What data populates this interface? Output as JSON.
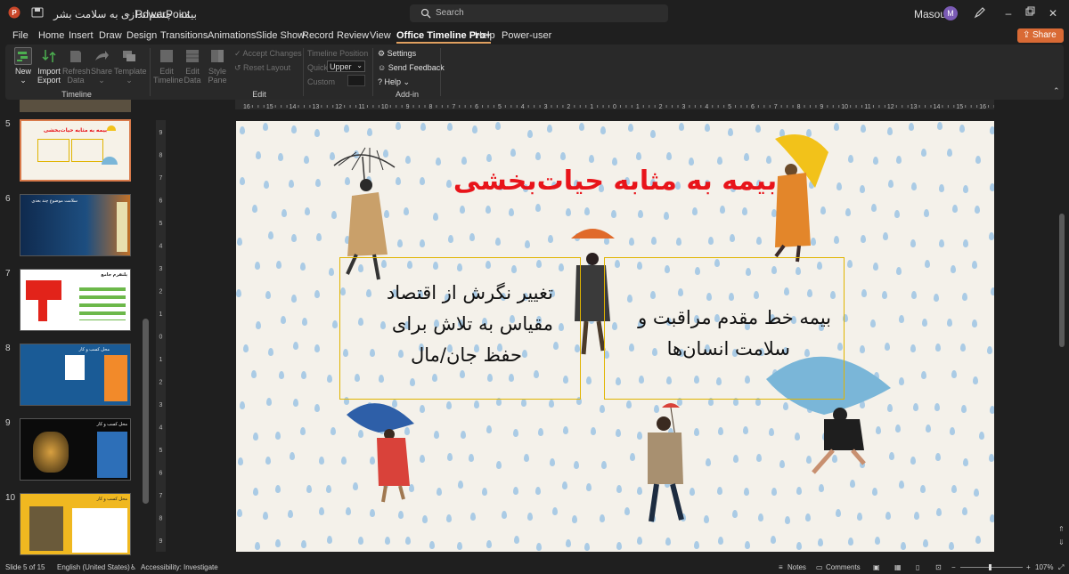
{
  "titlebar": {
    "autosave_label": "",
    "doc_title": "بیمه، چشم‌انداز‌ی به سلامت بشر",
    "app_name": "PowerPoint",
    "search_placeholder": "Search",
    "user_name": "Masoud",
    "avatar_initial": "M"
  },
  "menu": {
    "tabs": [
      "File",
      "Home",
      "Insert",
      "Draw",
      "Design",
      "Transitions",
      "Animations",
      "Slide Show",
      "Record",
      "Review",
      "View",
      "Office Timeline Pro+",
      "Help",
      "Power-user"
    ],
    "share_label": "Share"
  },
  "ribbon": {
    "new_label": "New",
    "import_label": "Import",
    "export_label": "Export",
    "refresh_label": "Refresh",
    "refresh_label2": "Data",
    "share_label": "Share",
    "template_label": "Template",
    "group_timeline": "Timeline",
    "accept_changes": "Accept Changes",
    "reset_layout": "Reset Layout",
    "edit_label": "Edit",
    "timeline_label": "Timeline",
    "data_label": "Data",
    "style_label": "Style",
    "pane_label": "Pane",
    "group_edit": "Edit",
    "timeline_position": "Timeline Position",
    "quick_label": "Quick",
    "quick_value": "Upper",
    "custom_label": "Custom",
    "settings_label": "Settings",
    "feedback_label": "Send Feedback",
    "help_label": "Help",
    "group_addin": "Add-in"
  },
  "thumbnails": [
    {
      "number": "5",
      "title": "بیمه به مثابه حیات‌بخشی"
    },
    {
      "number": "6",
      "title": "سلامت موضوع چند بعدی"
    },
    {
      "number": "7",
      "title": "پلتفرم جامع"
    },
    {
      "number": "8",
      "title": "محل کسب و کار"
    },
    {
      "number": "9",
      "title": "محل کسب و کار"
    },
    {
      "number": "10",
      "title": "محل کسب و کار"
    }
  ],
  "ruler": {
    "h_ticks": [
      "16",
      "15",
      "14",
      "13",
      "12",
      "11",
      "10",
      "9",
      "8",
      "7",
      "6",
      "5",
      "4",
      "3",
      "2",
      "1",
      "0",
      "1",
      "2",
      "3",
      "4",
      "5",
      "6",
      "7",
      "8",
      "9",
      "10",
      "11",
      "12",
      "13",
      "14",
      "15",
      "16"
    ],
    "v_ticks": [
      "9",
      "8",
      "7",
      "6",
      "5",
      "4",
      "3",
      "2",
      "1",
      "0",
      "1",
      "2",
      "3",
      "4",
      "5",
      "6",
      "7",
      "8",
      "9"
    ]
  },
  "slide": {
    "title": "بیمه به مثابه حیات‌بخشی",
    "left_box_lines": [
      "تغییر نگرش از اقتصاد",
      "مقیاس به تلاش برای",
      "حفظ جان/مال"
    ],
    "right_box_lines": [
      "بیمه خط مقدم مراقبت و",
      "سلامت انسان‌ها"
    ],
    "colors": {
      "title": "#e8141a",
      "box_border": "#e0b400",
      "background": "#f4f1ea",
      "raindrop": "#9cc4e4"
    }
  },
  "status": {
    "slide_info": "Slide 5 of 15",
    "language": "English (United States)",
    "accessibility": "Accessibility: Investigate",
    "notes": "Notes",
    "comments": "Comments",
    "zoom": "107%"
  }
}
